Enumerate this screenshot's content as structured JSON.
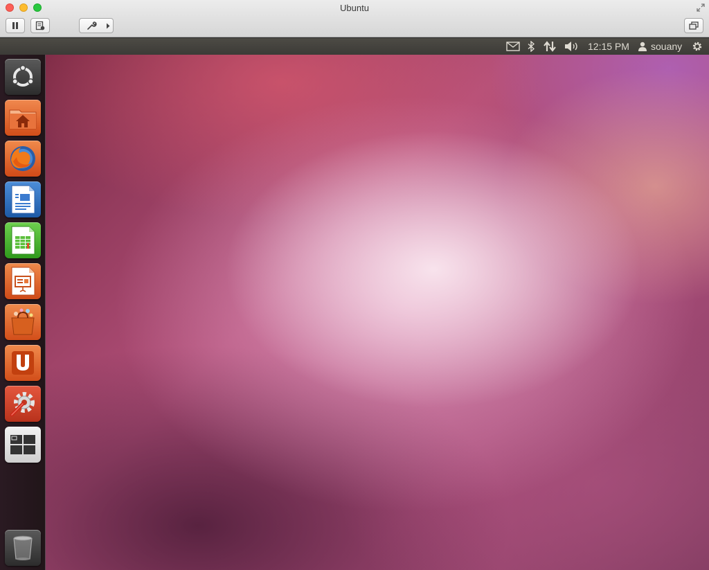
{
  "window": {
    "title": "Ubuntu"
  },
  "toolbar": {
    "buttons": [
      {
        "name": "pause",
        "icon": "pause-icon"
      },
      {
        "name": "snapshot",
        "icon": "snapshot-icon"
      },
      {
        "name": "settings",
        "icon": "wrench-icon"
      },
      {
        "name": "fullscreen",
        "icon": "window-restore-icon"
      }
    ]
  },
  "panel": {
    "clock": "12:15 PM",
    "user": "souany",
    "indicators": [
      "mail-icon",
      "bluetooth-icon",
      "network-icon",
      "volume-icon",
      "user-icon",
      "power-gear-icon"
    ]
  },
  "launcher": {
    "items": [
      {
        "name": "dash-home",
        "icon": "ubuntu-logo-icon"
      },
      {
        "name": "home-folder",
        "icon": "home-folder-icon"
      },
      {
        "name": "firefox",
        "icon": "firefox-icon"
      },
      {
        "name": "libreoffice-writer",
        "icon": "writer-icon"
      },
      {
        "name": "libreoffice-calc",
        "icon": "calc-icon"
      },
      {
        "name": "libreoffice-impress",
        "icon": "impress-icon"
      },
      {
        "name": "software-center",
        "icon": "shopping-bag-icon"
      },
      {
        "name": "ubuntu-one",
        "icon": "ubuntu-one-icon"
      },
      {
        "name": "system-settings",
        "icon": "settings-icon"
      },
      {
        "name": "workspace-switcher",
        "icon": "workspaces-icon"
      },
      {
        "name": "trash",
        "icon": "trash-icon"
      }
    ]
  },
  "colors": {
    "panel_bg": "#3c3b37",
    "panel_text": "#dfdbd2",
    "launcher_bg": "#211519",
    "ubuntu_orange": "#dd4814"
  }
}
